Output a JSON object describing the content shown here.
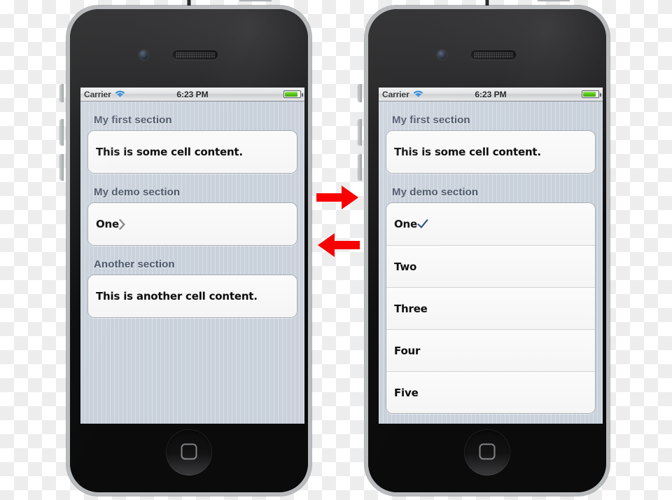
{
  "statusbar": {
    "carrier": "Carrier",
    "time": "6:23 PM",
    "wifi_icon": "wifi-icon",
    "battery_icon": "battery-icon"
  },
  "colors": {
    "accent_checkmark": "#2d4f82",
    "section_header_text": "#4a5568",
    "table_background": "#c9d1db",
    "cell_background": "#f7f7f7",
    "arrow_red": "#f80000"
  },
  "phone_left": {
    "name": "iphone-before",
    "sections": [
      {
        "header": "My first section",
        "cells": [
          {
            "label": "This is some cell content.",
            "accessory": "none"
          }
        ]
      },
      {
        "header": "My demo section",
        "cells": [
          {
            "label": "One",
            "accessory": "disclosure-chevron"
          }
        ]
      },
      {
        "header": "Another section",
        "cells": [
          {
            "label": "This is another cell content.",
            "accessory": "none"
          }
        ]
      }
    ]
  },
  "phone_right": {
    "name": "iphone-after",
    "sections": [
      {
        "header": "My first section",
        "cells": [
          {
            "label": "This is some cell content.",
            "accessory": "none"
          }
        ]
      },
      {
        "header": "My demo section",
        "cells": [
          {
            "label": "One",
            "accessory": "checkmark"
          },
          {
            "label": "Two",
            "accessory": "none"
          },
          {
            "label": "Three",
            "accessory": "none"
          },
          {
            "label": "Four",
            "accessory": "none"
          },
          {
            "label": "Five",
            "accessory": "none"
          }
        ]
      }
    ]
  },
  "arrows": [
    {
      "name": "arrow-right-icon",
      "direction": "right"
    },
    {
      "name": "arrow-left-icon",
      "direction": "left"
    }
  ]
}
